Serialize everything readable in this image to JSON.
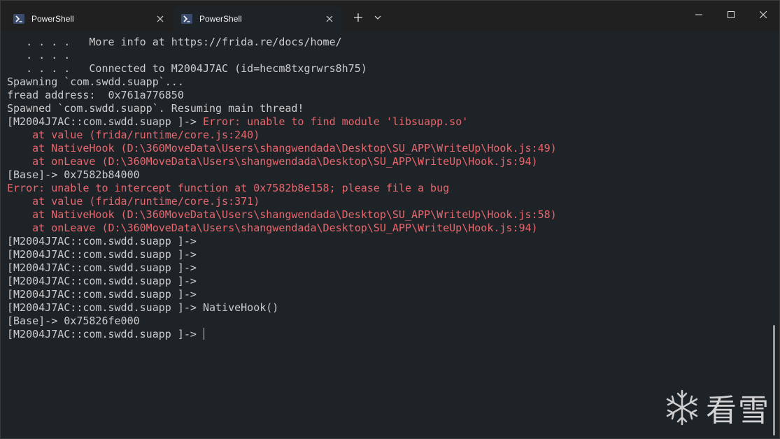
{
  "tabs": [
    {
      "label": "PowerShell",
      "active": false
    },
    {
      "label": "PowerShell",
      "active": true
    }
  ],
  "titlebar": {
    "new_tab_icon": "plus-icon",
    "dropdown_icon": "chevron-down-icon",
    "window_controls": [
      "minimize-icon",
      "maximize-icon",
      "close-icon"
    ]
  },
  "terminal": {
    "lines": [
      {
        "prompt": "   . . . .   More info at https://frida.re/docs/home/",
        "rest": ""
      },
      {
        "prompt": "   . . . .",
        "rest": ""
      },
      {
        "prompt": "   . . . .   Connected to M2004J7AC (id=hecm8txgrwrs8h75)",
        "rest": ""
      },
      {
        "prompt": "Spawning `com.swdd.suapp`...",
        "rest": ""
      },
      {
        "prompt": "fread address:  0x761a776850",
        "rest": ""
      },
      {
        "prompt": "Spawned `com.swdd.suapp`. Resuming main thread!",
        "rest": ""
      },
      {
        "prompt": "[M2004J7AC::com.swdd.suapp ]-> ",
        "rest": "Error: unable to find module 'libsuapp.so'",
        "rest_error": true
      },
      {
        "prompt": "",
        "rest": "    at value (frida/runtime/core.js:240)",
        "rest_error": true
      },
      {
        "prompt": "",
        "rest": "    at NativeHook (D:\\360MoveData\\Users\\shangwendada\\Desktop\\SU_APP\\WriteUp\\Hook.js:49)",
        "rest_error": true
      },
      {
        "prompt": "",
        "rest": "    at onLeave (D:\\360MoveData\\Users\\shangwendada\\Desktop\\SU_APP\\WriteUp\\Hook.js:94)",
        "rest_error": true
      },
      {
        "prompt": "[Base]-> 0x7582b84000",
        "rest": ""
      },
      {
        "prompt": "",
        "rest": "Error: unable to intercept function at 0x7582b8e158; please file a bug",
        "rest_error": true
      },
      {
        "prompt": "",
        "rest": "    at value (frida/runtime/core.js:371)",
        "rest_error": true
      },
      {
        "prompt": "",
        "rest": "    at NativeHook (D:\\360MoveData\\Users\\shangwendada\\Desktop\\SU_APP\\WriteUp\\Hook.js:58)",
        "rest_error": true
      },
      {
        "prompt": "",
        "rest": "    at onLeave (D:\\360MoveData\\Users\\shangwendada\\Desktop\\SU_APP\\WriteUp\\Hook.js:94)",
        "rest_error": true
      },
      {
        "prompt": "[M2004J7AC::com.swdd.suapp ]->",
        "rest": ""
      },
      {
        "prompt": "[M2004J7AC::com.swdd.suapp ]->",
        "rest": ""
      },
      {
        "prompt": "[M2004J7AC::com.swdd.suapp ]->",
        "rest": ""
      },
      {
        "prompt": "[M2004J7AC::com.swdd.suapp ]->",
        "rest": ""
      },
      {
        "prompt": "[M2004J7AC::com.swdd.suapp ]->",
        "rest": ""
      },
      {
        "prompt": "[M2004J7AC::com.swdd.suapp ]-> NativeHook()",
        "rest": ""
      },
      {
        "prompt": "[Base]-> 0x75826fe000",
        "rest": ""
      },
      {
        "prompt": "[M2004J7AC::com.swdd.suapp ]-> ",
        "rest": "",
        "cursor": true
      }
    ],
    "text_color": "#cccccc",
    "error_color": "#e7676d",
    "background": "#1e2328"
  },
  "watermark": {
    "icon": "snowflake-icon",
    "text": "看雪"
  }
}
